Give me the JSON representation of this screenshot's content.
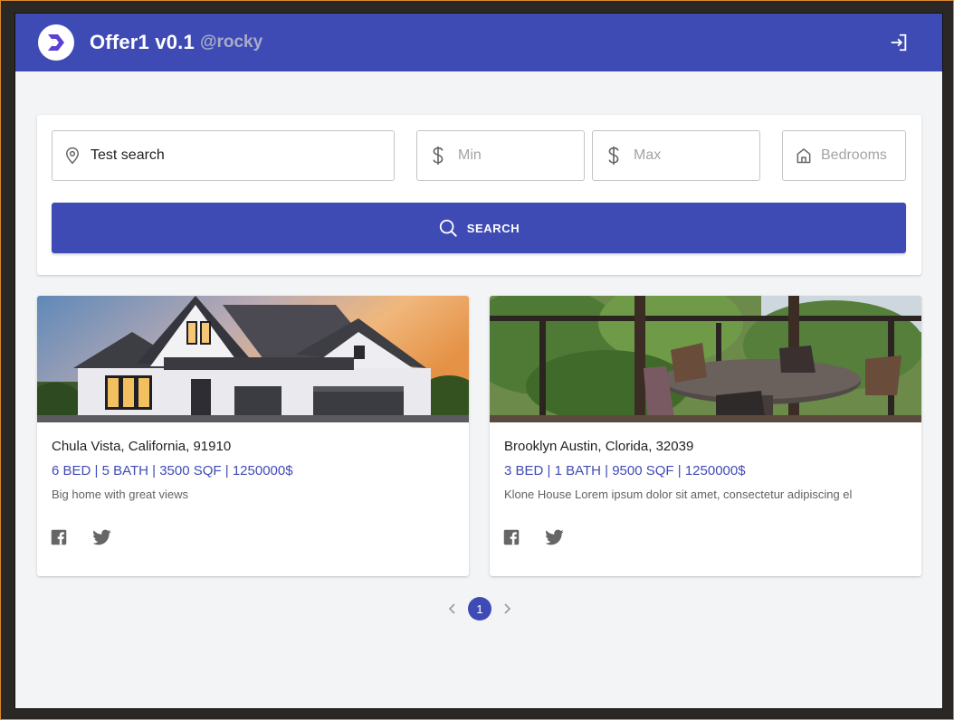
{
  "app": {
    "title": "Offer1 v0.1",
    "username": "@rocky",
    "brand_color": "#3f4bb5"
  },
  "search": {
    "location_value": "Test search",
    "location_icon": "map-pin-icon",
    "min_placeholder": "Min",
    "max_placeholder": "Max",
    "price_icon": "dollar-icon",
    "bedrooms_placeholder": "Bedrooms",
    "bedrooms_icon": "home-icon",
    "button_label": "SEARCH",
    "button_icon": "search-icon"
  },
  "listings": [
    {
      "address": "Chula Vista, California, 91910",
      "specs": "6 BED | 5 BATH | 3500 SQF | 1250000$",
      "description": "Big home with great views"
    },
    {
      "address": "Brooklyn Austin, Clorida, 32039",
      "specs": "3 BED | 1 BATH | 9500 SQF | 1250000$",
      "description": "Klone House Lorem ipsum dolor sit amet, consectetur adipiscing el"
    }
  ],
  "social_icons": [
    "facebook-icon",
    "twitter-icon"
  ],
  "pagination": {
    "current_page": "1"
  }
}
